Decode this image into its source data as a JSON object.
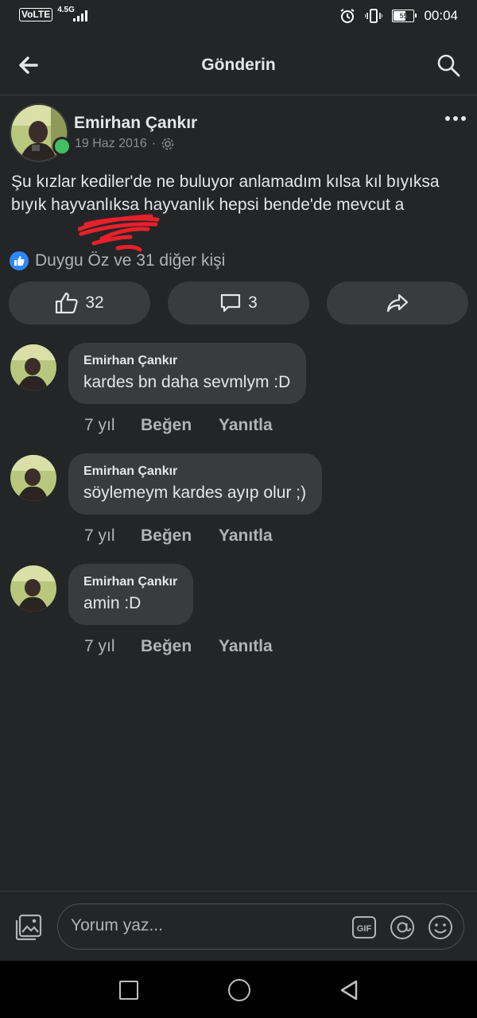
{
  "status_bar": {
    "volte": "VoLTE",
    "network": "4.5G",
    "battery": "55",
    "time": "00:04"
  },
  "header": {
    "title": "Gönderin"
  },
  "post": {
    "author": "Emirhan Çankır",
    "date": "19 Haz 2016",
    "separator": "·",
    "text": "Şu kızlar kediler'de ne buluyor anlamadım kılsa kıl bıyıksa bıyık hayvanlıksa hayvanlık hepsi bende'de mevcut a",
    "reactions_text": "Duygu Öz ve 31 diğer kişi",
    "like_count": "32",
    "comment_count": "3"
  },
  "comments": [
    {
      "name": "Emirhan Çankır",
      "text": "kardes bn daha sevmlym :D",
      "time": "7 yıl",
      "like_label": "Beğen",
      "reply_label": "Yanıtla"
    },
    {
      "name": "Emirhan Çankır",
      "text": "söylemeym kardes ayıp olur ;)",
      "time": "7 yıl",
      "like_label": "Beğen",
      "reply_label": "Yanıtla"
    },
    {
      "name": "Emirhan Çankır",
      "text": "amin :D",
      "time": "7 yıl",
      "like_label": "Beğen",
      "reply_label": "Yanıtla"
    }
  ],
  "composer": {
    "placeholder": "Yorum yaz...",
    "gif_label": "GIF"
  },
  "colors": {
    "background": "#242526",
    "surface": "#3a3b3c",
    "online": "#45bd62",
    "like_blue": "#2d88ff",
    "scribble": "#e8202a"
  },
  "icons": [
    "back-arrow-icon",
    "search-icon",
    "more-icon",
    "settings-icon",
    "like-icon",
    "comment-icon",
    "share-icon",
    "photo-icon",
    "gif-icon",
    "at-icon",
    "emoji-icon"
  ]
}
